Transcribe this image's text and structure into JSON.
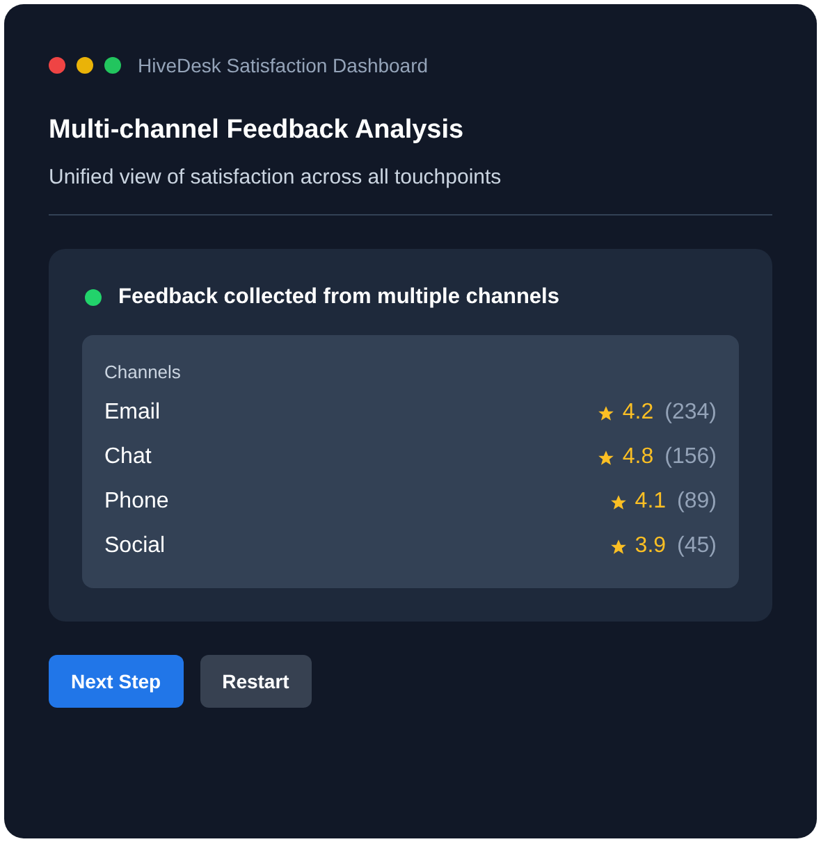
{
  "window": {
    "title": "HiveDesk Satisfaction Dashboard"
  },
  "heading": "Multi-channel Feedback Analysis",
  "subtitle": "Unified view of satisfaction across all touchpoints",
  "card": {
    "title": "Feedback collected from multiple channels",
    "list_label": "Channels",
    "channels": [
      {
        "name": "Email",
        "rating": "4.2",
        "count": "(234)"
      },
      {
        "name": "Chat",
        "rating": "4.8",
        "count": "(156)"
      },
      {
        "name": "Phone",
        "rating": "4.1",
        "count": "(89)"
      },
      {
        "name": "Social",
        "rating": "3.9",
        "count": "(45)"
      }
    ]
  },
  "buttons": [
    {
      "label": "Next Step",
      "kind": "primary"
    },
    {
      "label": "Restart",
      "kind": "secondary"
    }
  ]
}
